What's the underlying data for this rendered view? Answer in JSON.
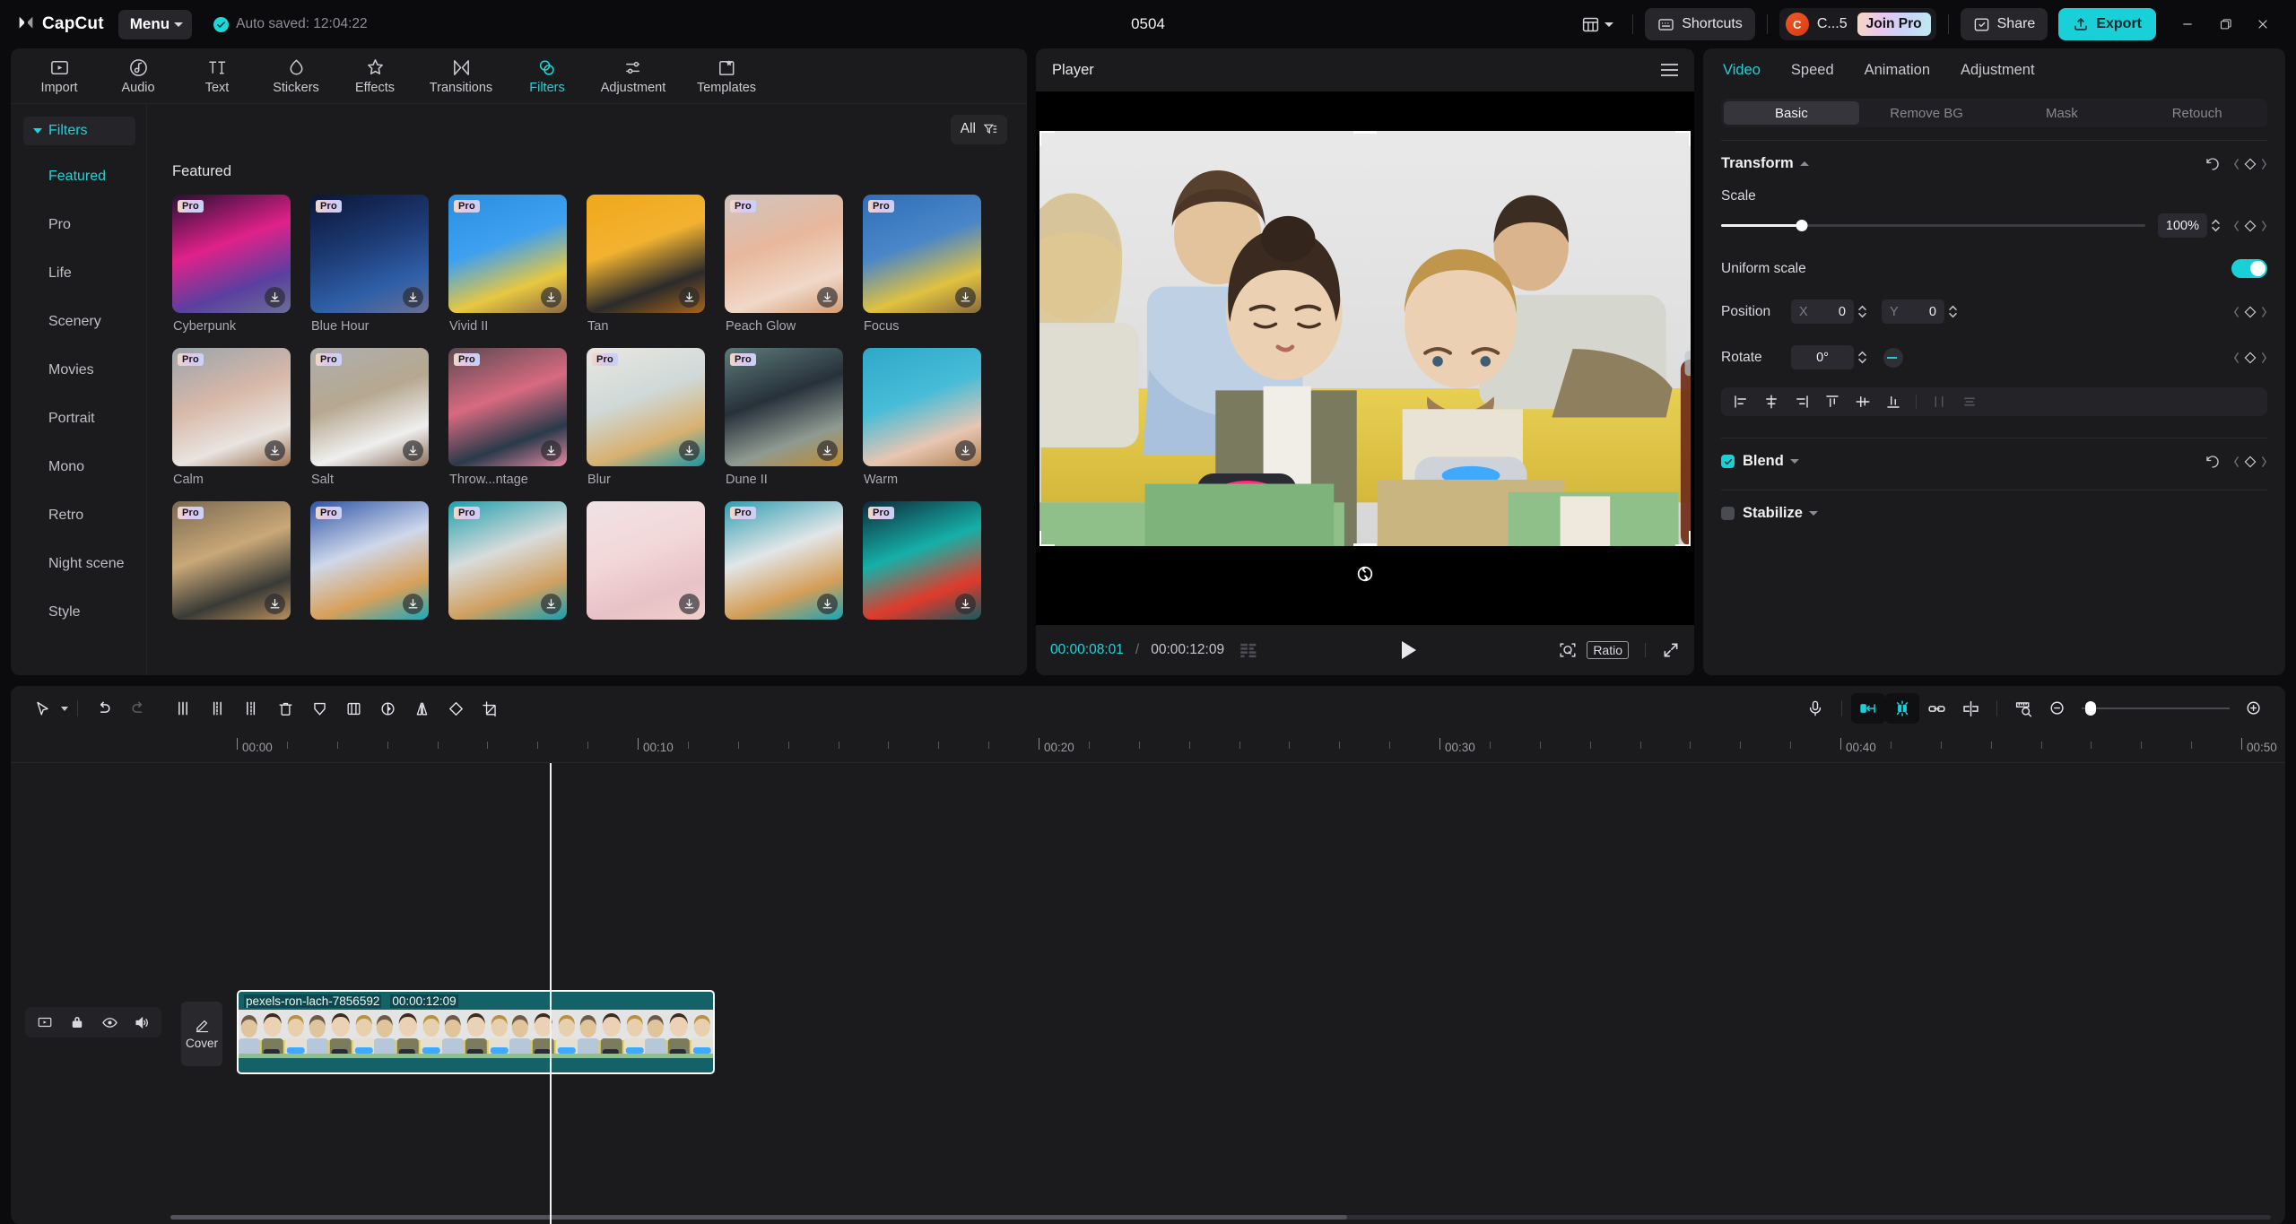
{
  "titlebar": {
    "brand": "CapCut",
    "menu_label": "Menu",
    "autosave": "Auto saved: 12:04:22",
    "project_title": "0504",
    "shortcuts_label": "Shortcuts",
    "account_initial": "C",
    "account_name": "C...5",
    "join_pro_label": "Join Pro",
    "share_label": "Share",
    "export_label": "Export"
  },
  "nav_tabs": [
    {
      "label": "Import",
      "icon": "import-icon",
      "active": false
    },
    {
      "label": "Audio",
      "icon": "audio-icon",
      "active": false
    },
    {
      "label": "Text",
      "icon": "text-icon",
      "active": false
    },
    {
      "label": "Stickers",
      "icon": "stickers-icon",
      "active": false
    },
    {
      "label": "Effects",
      "icon": "effects-icon",
      "active": false
    },
    {
      "label": "Transitions",
      "icon": "transitions-icon",
      "active": false
    },
    {
      "label": "Filters",
      "icon": "filters-icon",
      "active": true
    },
    {
      "label": "Adjustment",
      "icon": "adjustment-icon",
      "active": false
    },
    {
      "label": "Templates",
      "icon": "templates-icon",
      "active": false
    }
  ],
  "library": {
    "category_header": "Filters",
    "categories": [
      {
        "label": "Featured",
        "active": true
      },
      {
        "label": "Pro",
        "active": false
      },
      {
        "label": "Life",
        "active": false
      },
      {
        "label": "Scenery",
        "active": false
      },
      {
        "label": "Movies",
        "active": false
      },
      {
        "label": "Portrait",
        "active": false
      },
      {
        "label": "Mono",
        "active": false
      },
      {
        "label": "Retro",
        "active": false
      },
      {
        "label": "Night scene",
        "active": false
      },
      {
        "label": "Style",
        "active": false
      }
    ],
    "filter_button_label": "All",
    "section_title": "Featured",
    "pro_badge": "Pro",
    "filters": [
      {
        "name": "Cyberpunk",
        "pro": true,
        "download": true,
        "c1": "#2a0f33",
        "c2": "#e0218a",
        "c3": "#5a3fa0",
        "c4": "#6a6f95"
      },
      {
        "name": "Blue Hour",
        "pro": true,
        "download": true,
        "c1": "#0b1638",
        "c2": "#1d3a73",
        "c3": "#2f5fa8",
        "c4": "#6a6f95"
      },
      {
        "name": "Vivid II",
        "pro": true,
        "download": true,
        "c1": "#2a8fe0",
        "c2": "#3fa0f0",
        "c3": "#e8c840",
        "c4": "#8a6a42"
      },
      {
        "name": "Tan",
        "pro": false,
        "download": true,
        "c1": "#f0a81c",
        "c2": "#f2b230",
        "c3": "#2b2b2b",
        "c4": "#a6641a"
      },
      {
        "name": "Peach Glow",
        "pro": true,
        "download": true,
        "c1": "#cfc4c0",
        "c2": "#e8b89c",
        "c3": "#f0d8c8",
        "c4": "#d49a72"
      },
      {
        "name": "Focus",
        "pro": true,
        "download": true,
        "c1": "#2f6fb8",
        "c2": "#4a86c8",
        "c3": "#e0c240",
        "c4": "#8a6a3a"
      },
      {
        "name": "Calm",
        "pro": true,
        "download": true,
        "c1": "#9aa4ac",
        "c2": "#d8b8a8",
        "c3": "#e8e4e0",
        "c4": "#9c7050"
      },
      {
        "name": "Salt",
        "pro": true,
        "download": true,
        "c1": "#aeaeae",
        "c2": "#b6a890",
        "c3": "#efefef",
        "c4": "#8c6f5c"
      },
      {
        "name": "Throw...ntage",
        "pro": true,
        "download": true,
        "c1": "#5a4a52",
        "c2": "#d86a80",
        "c3": "#2a3a4a",
        "c4": "#e58aa4"
      },
      {
        "name": "Blur",
        "pro": true,
        "download": true,
        "c1": "#eae6e0",
        "c2": "#cfd9d8",
        "c3": "#d8b070",
        "c4": "#1896a4"
      },
      {
        "name": "Dune II",
        "pro": true,
        "download": true,
        "c1": "#5d7b7a",
        "c2": "#27313a",
        "c3": "#8f9a92",
        "c4": "#c08a2a"
      },
      {
        "name": "Warm",
        "pro": false,
        "download": true,
        "c1": "#2fa8c8",
        "c2": "#46bcd8",
        "c3": "#e8c6b2",
        "c4": "#b08050"
      },
      {
        "name": "",
        "pro": true,
        "download": true,
        "c1": "#7a6a52",
        "c2": "#c9a878",
        "c3": "#3a3a36",
        "c4": "#b89060"
      },
      {
        "name": "",
        "pro": true,
        "download": true,
        "c1": "#2f55a8",
        "c2": "#cfd8ea",
        "c3": "#d8a05a",
        "c4": "#19a8bc"
      },
      {
        "name": "",
        "pro": true,
        "download": true,
        "c1": "#1fa0ad",
        "c2": "#d8dcdc",
        "c3": "#d0a060",
        "c4": "#16a0b0"
      },
      {
        "name": "",
        "pro": false,
        "download": true,
        "c1": "#efe2e6",
        "c2": "#f3d8d8",
        "c3": "#e8c2c6",
        "c4": "#efd0cc"
      },
      {
        "name": "",
        "pro": true,
        "download": true,
        "c1": "#2f9fb2",
        "c2": "#e2e6e8",
        "c3": "#d49e58",
        "c4": "#1aa4b4"
      },
      {
        "name": "",
        "pro": true,
        "download": true,
        "c1": "#0e2a38",
        "c2": "#15b0a8",
        "c3": "#e03a2a",
        "c4": "#125a60"
      }
    ]
  },
  "player": {
    "title": "Player",
    "current_time": "00:00:08:01",
    "total_time": "00:00:12:09",
    "separator": "/",
    "ratio_label": "Ratio"
  },
  "inspector": {
    "tabs": [
      {
        "label": "Video",
        "active": true
      },
      {
        "label": "Speed",
        "active": false
      },
      {
        "label": "Animation",
        "active": false
      },
      {
        "label": "Adjustment",
        "active": false
      }
    ],
    "segments": [
      {
        "label": "Basic",
        "active": true
      },
      {
        "label": "Remove BG",
        "active": false
      },
      {
        "label": "Mask",
        "active": false
      },
      {
        "label": "Retouch",
        "active": false
      }
    ],
    "transform_label": "Transform",
    "scale_label": "Scale",
    "scale_value": "100%",
    "uniform_scale_label": "Uniform scale",
    "uniform_scale_on": true,
    "position_label": "Position",
    "position_x_axis": "X",
    "position_x_value": "0",
    "position_y_axis": "Y",
    "position_y_value": "0",
    "rotate_label": "Rotate",
    "rotate_value": "0°",
    "blend_label": "Blend",
    "blend_checked": true,
    "stabilize_label": "Stabilize",
    "stabilize_checked": false
  },
  "timeline": {
    "ruler_labels": [
      "00:00",
      "00:10",
      "00:20",
      "00:30",
      "00:40",
      "00:50"
    ],
    "cover_label": "Cover",
    "clip_name": "pexels-ron-lach-7856592",
    "clip_duration": "00:00:12:09"
  },
  "colors": {
    "accent": "#1ad0d8",
    "clip": "#146268",
    "panel": "#1b1b1e",
    "background": "#0b0b0d"
  }
}
